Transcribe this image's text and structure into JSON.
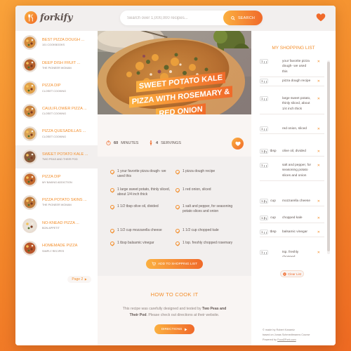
{
  "app": {
    "logo_text": "forkify",
    "search_placeholder": "Search over 1,000,000 recipes...",
    "search_button": "SEARCH"
  },
  "colors": {
    "accent_start": "#fbb040",
    "accent_end": "#f06a2a",
    "text": "#615551"
  },
  "results": [
    {
      "title": "BEST PIZZA DOUGH ...",
      "publisher": "101 COOKBOOKS",
      "active": false
    },
    {
      "title": "DEEP DISH FRUIT ...",
      "publisher": "THE PIONEER WOMAN",
      "active": false
    },
    {
      "title": "PIZZA DIP",
      "publisher": "CLOSET COOKING",
      "active": false
    },
    {
      "title": "CAULIFLOWER PIZZA ...",
      "publisher": "CLOSET COOKING",
      "active": false
    },
    {
      "title": "PIZZA QUESADILLAS ...",
      "publisher": "CLOSET COOKING",
      "active": false
    },
    {
      "title": "SWEET POTATO KALE ...",
      "publisher": "TWO PEAS AND THEIR POD",
      "active": true
    },
    {
      "title": "PIZZA DIP",
      "publisher": "MY BAKING ADDICTION",
      "active": false
    },
    {
      "title": "PIZZA POTATO SKINS ...",
      "publisher": "THE PIONEER WOMAN",
      "active": false
    },
    {
      "title": "NO-KNEAD PIZZA ...",
      "publisher": "BON APPETIT",
      "active": false
    },
    {
      "title": "HOMEMADE PIZZA",
      "publisher": "SIMPLY RECIPES",
      "active": false
    }
  ],
  "pagination": {
    "label": "Page 2"
  },
  "recipe": {
    "title_lines": [
      "SWEET POTATO KALE",
      "PIZZA WITH ROSEMARY &",
      "RED ONION"
    ],
    "minutes": "60",
    "minutes_label": "MINUTES",
    "servings": "4",
    "servings_label": "SERVINGS",
    "ingredients": [
      "1 your favorite pizza dough- we used this",
      "1 pizza dough recipe",
      "1 large sweet potato, thinly sliced, about 1/4 inch thick",
      "1 red onion, sliced",
      "1 1/2 tbsp olive oil, divided",
      "1 salt and pepper, for seasoning potato slices and onion",
      "1 1/2 cup mozzarella cheese",
      "1 1/2 cup chopped kale",
      "1 tbsp balsamic vinegar",
      "1 tsp. freshly chopped rosemary"
    ],
    "add_to_list": "ADD TO SHOPPING LIST"
  },
  "howto": {
    "title": "HOW TO COOK IT",
    "text_before": "This recipe was carefully designed and tested by ",
    "publisher": "Two Peas and Their Pod",
    "text_after": ". Please check out directions at their website.",
    "button": "DIRECTIONS"
  },
  "shopping": {
    "title": "MY SHOPPING LIST",
    "items": [
      {
        "qty": "1",
        "unit": "",
        "name": "your favorite pizza dough- we used this"
      },
      {
        "qty": "1",
        "unit": "",
        "name": "pizza dough recipe"
      },
      {
        "qty": "1",
        "unit": "",
        "name": "large sweet potato, thinly sliced, about 1/4 inch thick"
      },
      {
        "qty": "1",
        "unit": "",
        "name": "red onion, sliced"
      },
      {
        "qty": "1.5",
        "unit": "tbsp",
        "name": "olive oil, divided"
      },
      {
        "qty": "1",
        "unit": "",
        "name": "salt and pepper, for seasoning potato slices and onion"
      },
      {
        "qty": "1.5",
        "unit": "cup",
        "name": "mozzarella cheese"
      },
      {
        "qty": "1.5",
        "unit": "cup",
        "name": "chopped kale"
      },
      {
        "qty": "1",
        "unit": "tbsp",
        "name": "balsamic vinegar"
      },
      {
        "qty": "1",
        "unit": "",
        "name": "tsp. freshly chopped"
      }
    ],
    "clear_label": "Clear List"
  },
  "copyright": {
    "line1": "© made by Robert Karamiz",
    "line2": "based on Jonas Schmedtmanns Course",
    "line3_prefix": "Powered by ",
    "line3_link": "Food2Fork.com"
  }
}
